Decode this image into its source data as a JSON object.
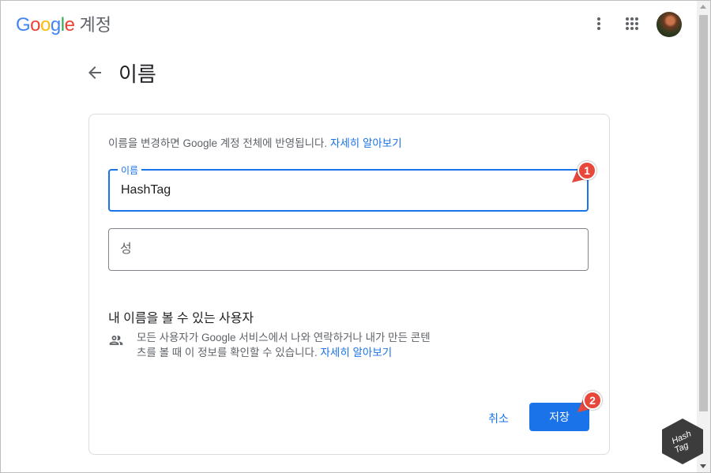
{
  "header": {
    "logo_google": "Google",
    "logo_suffix": "계정",
    "menu_icon": "more-vert-icon",
    "apps_icon": "apps-grid-icon",
    "avatar": "user-avatar"
  },
  "page": {
    "back_icon": "arrow-back-icon",
    "title": "이름"
  },
  "card": {
    "description": "이름을 변경하면 Google 계정 전체에 반영됩니다.",
    "learn_more": "자세히 알아보기",
    "first_name": {
      "label": "이름",
      "value": "HashTag"
    },
    "last_name": {
      "placeholder": "성",
      "value": ""
    },
    "visibility_title": "내 이름을 볼 수 있는 사용자",
    "visibility_icon": "people-icon",
    "visibility_text": "모든 사용자가 Google 서비스에서 나와 연락하거나 내가 만든 콘텐츠를 볼 때 이 정보를 확인할 수 있습니다.",
    "visibility_link": "자세히 알아보기",
    "cancel_label": "취소",
    "save_label": "저장"
  },
  "callouts": {
    "one": "1",
    "two": "2"
  },
  "watermark": {
    "line1": "Hash",
    "line2": "Tag"
  },
  "colors": {
    "accent": "#1a73e8",
    "callout": "#e8473b"
  }
}
